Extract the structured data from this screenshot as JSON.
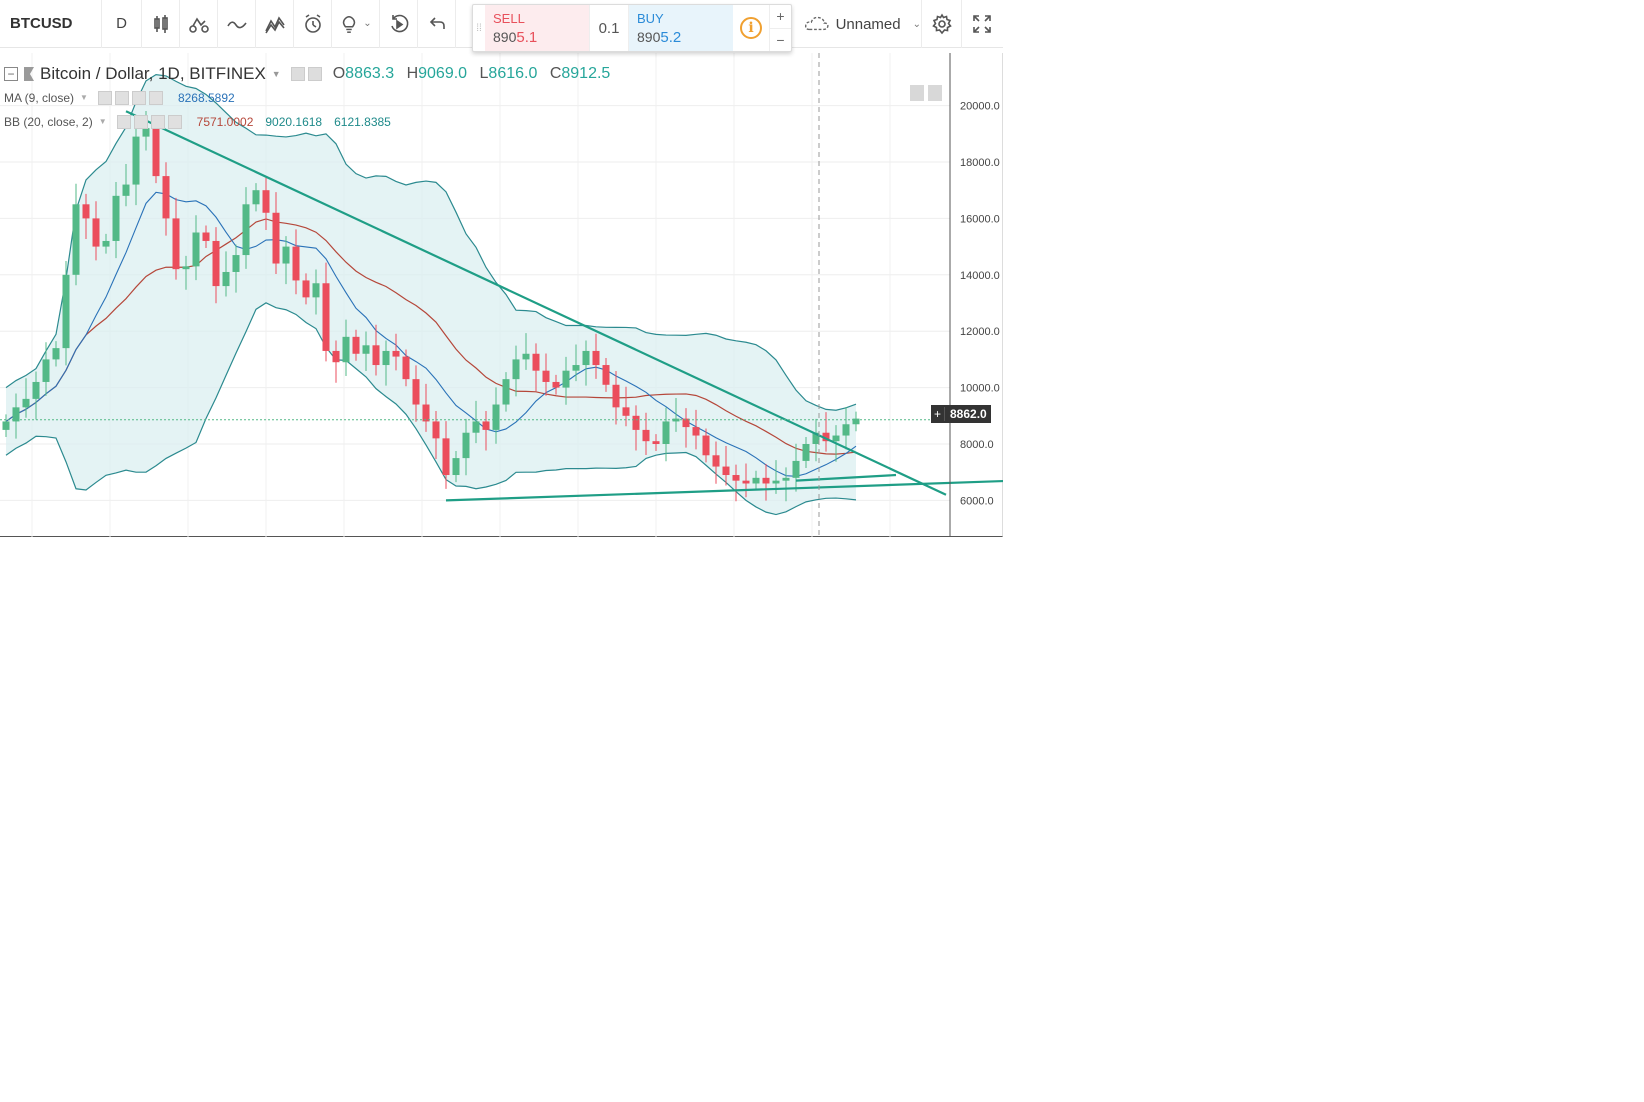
{
  "toolbar": {
    "symbol": "BTCUSD",
    "interval": "D",
    "icons": [
      "candles-icon",
      "indicators-icon",
      "compare-icon",
      "templates-icon",
      "alert-icon",
      "idea-icon",
      "replay-icon",
      "undo-icon"
    ]
  },
  "trade": {
    "sell_label": "SELL",
    "sell_prefix": "890",
    "sell_suffix": "5.1",
    "qty": "0.1",
    "buy_label": "BUY",
    "buy_prefix": "890",
    "buy_suffix": "5.2",
    "info": "i",
    "plus": "+",
    "minus": "−"
  },
  "layout": {
    "name": "Unnamed"
  },
  "legend": {
    "title": "Bitcoin / Dollar, 1D, BITFINEX",
    "o_label": "O",
    "o_value": "8863.3",
    "h_label": "H",
    "h_value": "9069.0",
    "l_label": "L",
    "l_value": "8616.0",
    "c_label": "C",
    "c_value": "8912.5",
    "ma_name": "MA (9, close)",
    "ma_value": "8268.5892",
    "bb_name": "BB (20, close, 2)",
    "bb_basis": "7571.0002",
    "bb_upper": "9020.1618",
    "bb_lower": "6121.8385"
  },
  "price_axis": {
    "ticks": [
      "20000.0",
      "18000.0",
      "16000.0",
      "14000.0",
      "12000.0",
      "10000.0",
      "8000.0",
      "6000.0"
    ],
    "current": "8862.0"
  },
  "colors": {
    "up": "#53b987",
    "down": "#eb4d5c",
    "trendline": "#1f9e86",
    "bb_band": "#2b8a8f",
    "bb_fill": "#d9eef0",
    "ma": "#8b2a2a",
    "bb_basis": "#b5473a"
  },
  "chart_data": {
    "type": "candlestick",
    "symbol": "BTCUSD",
    "exchange": "BITFINEX",
    "interval": "1D",
    "ylim": [
      5000,
      21000
    ],
    "close": [
      8800,
      9300,
      9600,
      10200,
      11000,
      11400,
      14000,
      16500,
      16000,
      15000,
      15200,
      16800,
      17200,
      18900,
      19200,
      17500,
      16000,
      14200,
      14300,
      15500,
      15200,
      13600,
      14100,
      14700,
      16500,
      17000,
      16200,
      14400,
      15000,
      13800,
      13200,
      13700,
      11300,
      10900,
      11800,
      11200,
      11500,
      10800,
      11300,
      11100,
      10300,
      9400,
      8800,
      8200,
      6900,
      7500,
      8400,
      8800,
      8500,
      9400,
      10300,
      11000,
      11200,
      10600,
      10200,
      10000,
      10600,
      10800,
      11300,
      10800,
      10100,
      9300,
      9000,
      8500,
      8100,
      8000,
      8800,
      8900,
      8600,
      8300,
      7600,
      7200,
      6900,
      6700,
      6600,
      6800,
      6600,
      6700,
      6800,
      7400,
      8000,
      8400,
      8100,
      8300,
      8700,
      8900
    ],
    "ma_last": 8268.5892,
    "bb_basis_last": 7571.0002,
    "bb_upper_last": 9020.1618,
    "bb_lower_last": 6121.8385,
    "current_price": 8862.0,
    "ohlc_last": {
      "open": 8863.3,
      "high": 9069.0,
      "low": 8616.0,
      "close": 8912.5
    },
    "trendlines": [
      {
        "from": [
          14,
          19800
        ],
        "to": [
          96,
          6200
        ]
      },
      {
        "from": [
          46,
          6000
        ],
        "to": [
          111,
          6800
        ]
      },
      {
        "from": [
          81,
          6700
        ],
        "to": [
          91,
          6900
        ]
      }
    ]
  }
}
